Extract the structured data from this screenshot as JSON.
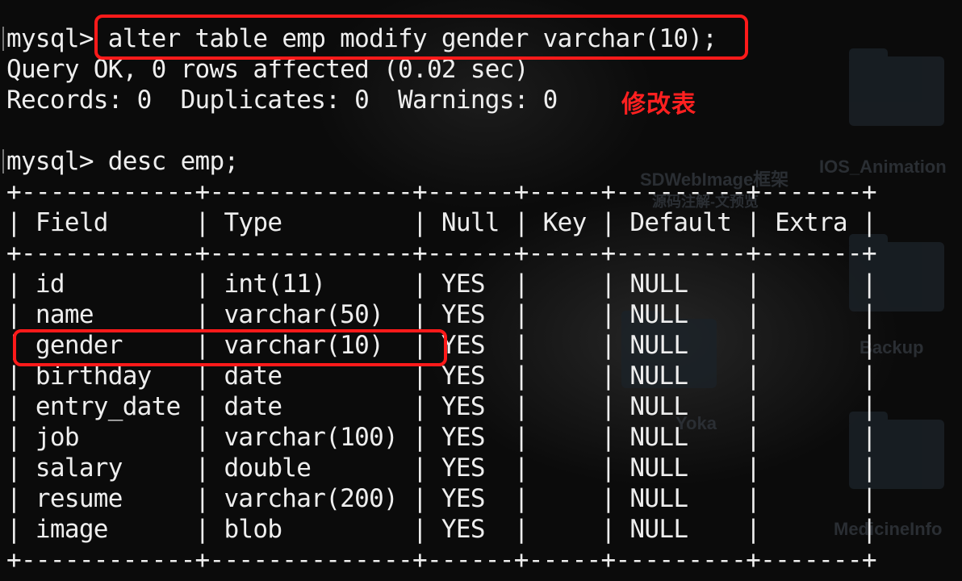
{
  "terminal": {
    "command_1": {
      "prompt": "mysql>",
      "command": "alter table emp modify gender varchar(10);"
    },
    "output_1": "Query OK, 0 rows affected (0.02 sec)",
    "output_2": "Records: 0  Duplicates: 0  Warnings: 0",
    "command_2": {
      "prompt": "mysql>",
      "command": "desc emp;"
    },
    "table": {
      "border": "+------------+--------------+------+-----+---------+-------+",
      "header": "| Field      | Type         | Null | Key | Default | Extra |",
      "rows": [
        "| id         | int(11)      | YES  |     | NULL    |       |",
        "| name       | varchar(50)  | YES  |     | NULL    |       |",
        "| gender     | varchar(10)  | YES  |     | NULL    |       |",
        "| birthday   | date         | YES  |     | NULL    |       |",
        "| entry_date | date         | YES  |     | NULL    |       |",
        "| job        | varchar(100) | YES  |     | NULL    |       |",
        "| salary     | double       | YES  |     | NULL    |       |",
        "| resume     | varchar(200) | YES  |     | NULL    |       |",
        "| image      | blob         | YES  |     | NULL    |       |"
      ]
    }
  },
  "annotation": {
    "text": "修改表",
    "color": "#ff2020"
  },
  "desktop": {
    "labels": [
      "SDWebImage框架",
      "源码注解-文预览",
      "IOS_Animation",
      "Backup",
      "Yoka",
      "MedicineInfo"
    ]
  }
}
